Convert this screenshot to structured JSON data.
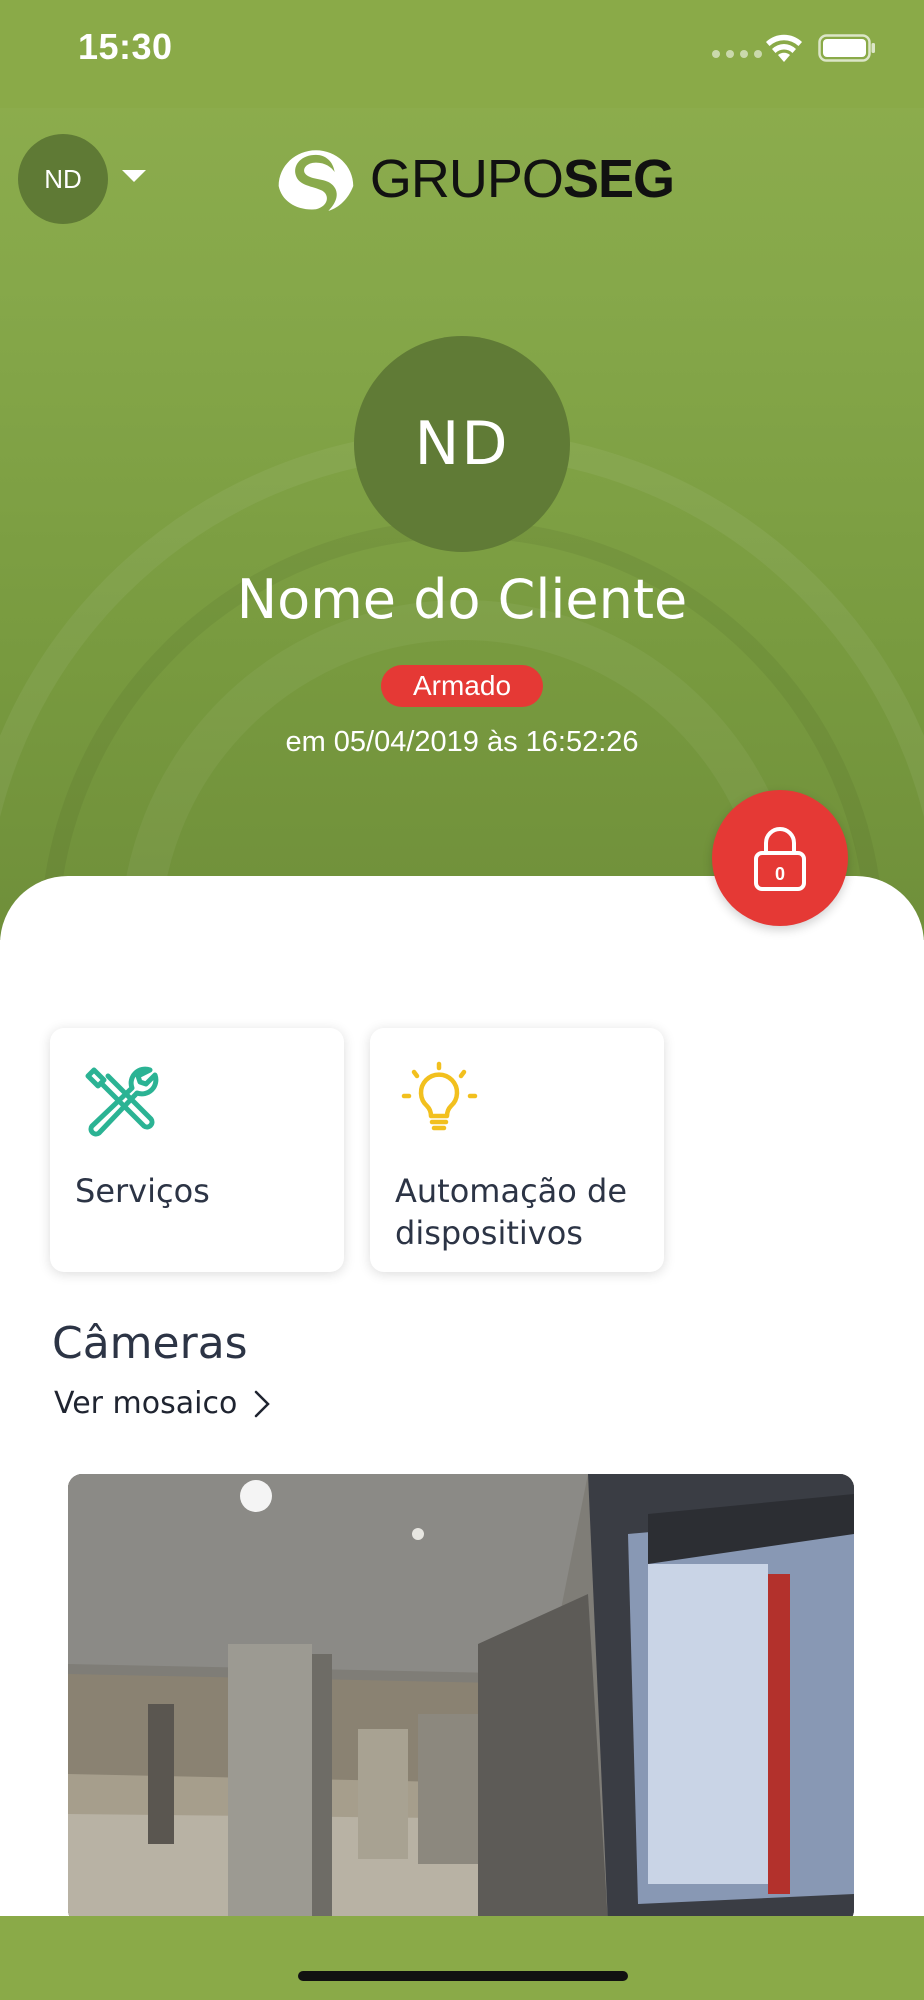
{
  "status_bar": {
    "time": "15:30",
    "icons": [
      "signal-icon",
      "wifi-icon",
      "battery-icon"
    ]
  },
  "header": {
    "avatar_initials": "ND",
    "logo_text_light": "GRUPO",
    "logo_text_bold": "SEG",
    "menu_icon": "chevron-down-icon"
  },
  "profile": {
    "initials": "ND",
    "name": "Nome do Cliente",
    "status_label": "Armado",
    "status_timestamp": "em 05/04/2019 às 16:52:26",
    "lock_badge": "0"
  },
  "tiles": [
    {
      "label": "Serviços",
      "icon": "tools-icon"
    },
    {
      "label": "Automação de dispositivos",
      "icon": "lightbulb-icon"
    }
  ],
  "cameras": {
    "title": "Câmeras",
    "link_label": "Ver mosaico",
    "link_icon": "chevron-right-icon"
  },
  "colors": {
    "brand_green": "#8aaa48",
    "status_red": "#e53935",
    "tools_icon": "#2bb394",
    "bulb_icon": "#f2c01e",
    "text_dark": "#2c3445"
  }
}
